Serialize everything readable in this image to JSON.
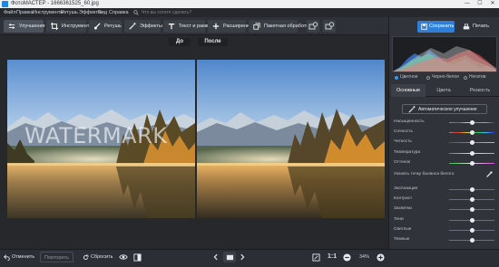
{
  "titlebar": {
    "title": "ФотоМАСТЕР - 1666361525_60.jpg",
    "minimize": "—",
    "maximize": "☐",
    "close": "✕"
  },
  "menu": {
    "items": [
      "Файл",
      "Правка",
      "Инструменты",
      "Ретушь",
      "Эффекты",
      "Вид",
      "Справка"
    ],
    "search_placeholder": "Что вы хотите сделать?"
  },
  "toolbar": {
    "buttons": [
      "Улучшения",
      "Инструменты",
      "Ретушь",
      "Эффекты",
      "Текст и рамки",
      "Расширения",
      "Пакетная обработка"
    ]
  },
  "compare": {
    "before": "До",
    "after": "После"
  },
  "watermark": "WATERMARK",
  "status": {
    "undo": "Отменить",
    "redo": "Повторить",
    "reset": "Сбросить",
    "ratio": "1:1",
    "zoom": "34%"
  },
  "panel": {
    "save": "Сохранить",
    "print": "Печать",
    "histogram_modes": [
      "Цветное",
      "Черно-белое",
      "Негатив"
    ],
    "tabs": [
      "Основные",
      "Цвета",
      "Резкость"
    ],
    "auto_enhance": "Автоматическое улучшение",
    "sliders": [
      {
        "label": "Насыщенность",
        "value": 0.5,
        "gradient": "sat"
      },
      {
        "label": "Сочность",
        "value": 0.5,
        "gradient": "sat"
      },
      {
        "label": "Четкость",
        "value": 0.5,
        "gradient": "gray"
      },
      {
        "label": "Температура",
        "value": 0.5,
        "gradient": "temp"
      },
      {
        "label": "Оттенок",
        "value": 0.5,
        "gradient": "tint"
      }
    ],
    "white_balance_label": "Указать точку баланса белого",
    "tone_sliders": [
      {
        "label": "Экспозиция",
        "value": 0.5
      },
      {
        "label": "Контраст",
        "value": 0.5
      },
      {
        "label": "Засветки",
        "value": 0.5
      },
      {
        "label": "Тени",
        "value": 0.5
      },
      {
        "label": "Светлые",
        "value": 0.5
      },
      {
        "label": "Темные",
        "value": 0.5
      }
    ]
  },
  "colors": {
    "accent": "#2f7fd8",
    "panel": "#30333a",
    "toolbar": "#2e3137"
  }
}
